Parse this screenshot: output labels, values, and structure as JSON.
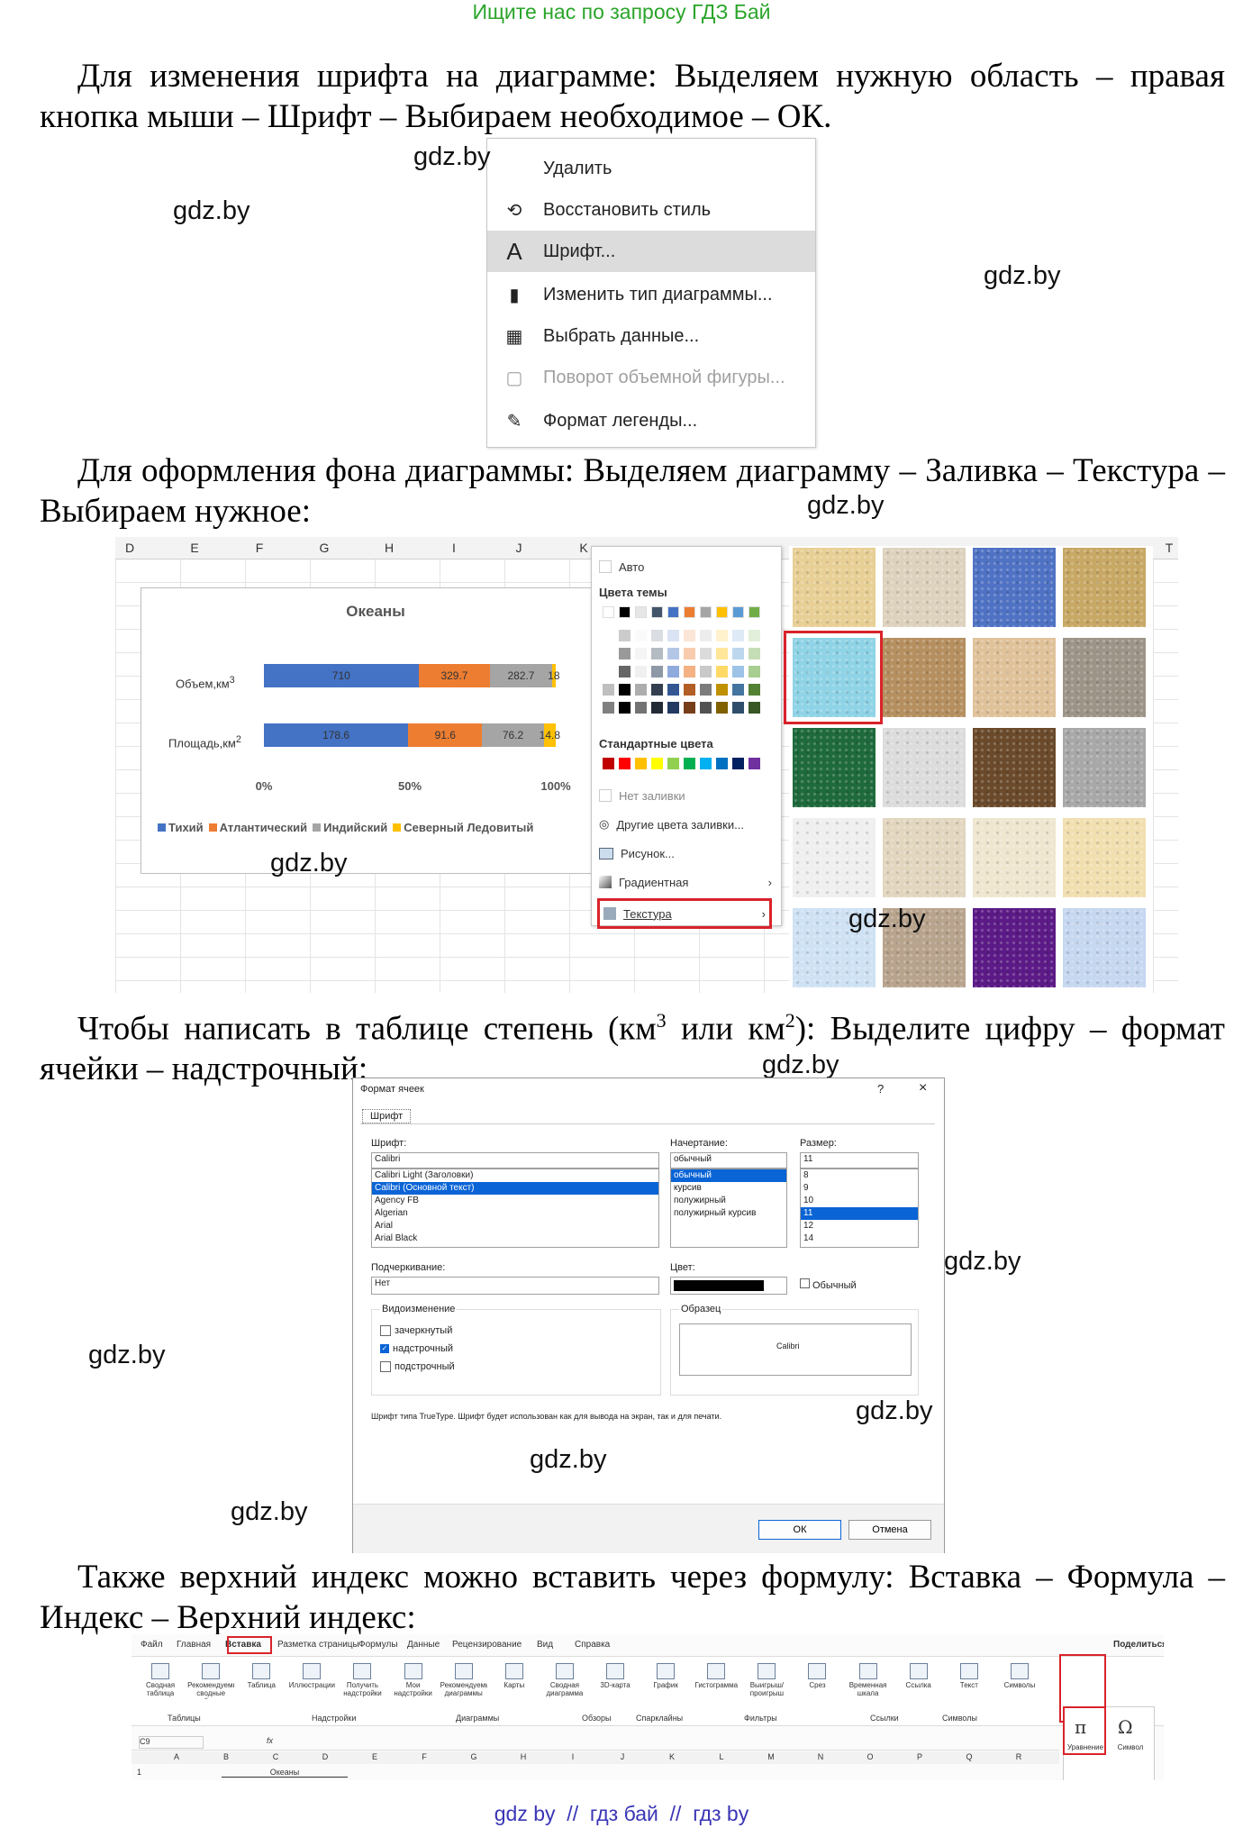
{
  "header_link": "Ищите нас по запросу ГДЗ Бай",
  "p1": "Для изменения шрифта на диаграмме: Выделяем нужную область – правая кнопка мыши – Шрифт – Выбираем необходимое – ОК.",
  "p2": "Для оформления фона диаграммы: Выделяем диаграмму – Заливка – Текстура – Выбираем нужное:",
  "p3_a": "Чтобы написать в таблице степень (км",
  "p3_sup1": "3",
  "p3_b": " или км",
  "p3_sup2": "2",
  "p3_c": "): Выделите цифру – формат ячейки – надстрочный:",
  "p4": "Также верхний индекс можно вставить через формулу: Вставка – Формула – Индекс – Верхний индекс:",
  "watermark": "gdz.by",
  "footer": "gdz by  //  гдз бай  //  гдз by",
  "context_menu": {
    "items": [
      {
        "label": "Удалить",
        "icon": "none"
      },
      {
        "label": "Восстановить стиль",
        "icon": "reset-style-icon"
      },
      {
        "label": "Шрифт...",
        "icon": "font-icon"
      },
      {
        "label": "Изменить тип диаграммы...",
        "icon": "chart-type-icon"
      },
      {
        "label": "Выбрать данные...",
        "icon": "select-data-icon"
      },
      {
        "label": "Поворот объемной фигуры...",
        "icon": "rotate-3d-icon"
      },
      {
        "label": "Формат легенды...",
        "icon": "format-legend-icon"
      }
    ]
  },
  "excel_chart": {
    "columns": [
      "D",
      "E",
      "F",
      "G",
      "H",
      "I",
      "J",
      "K"
    ],
    "right_column": "T",
    "title": "Океаны",
    "row1_label": "Объем,км",
    "row1_sup": "3",
    "row2_label": "Площадь,км",
    "row2_sup": "2",
    "row1_values": [
      "710",
      "329.7",
      "282.7",
      "18"
    ],
    "row2_values": [
      "178.6",
      "91.6",
      "76.2",
      "14.8"
    ],
    "x_ticks": [
      "0%",
      "50%",
      "100%"
    ],
    "legend": [
      "Тихий",
      "Атлантический",
      "Индийский",
      "Северный Ледовитый"
    ],
    "series_colors": [
      "#4472c4",
      "#ed7d31",
      "#a5a5a5",
      "#ffc000"
    ]
  },
  "chart_data": {
    "type": "bar",
    "title": "Океаны",
    "categories": [
      "Объем,км³",
      "Площадь,км²"
    ],
    "series": [
      {
        "name": "Тихий",
        "values": [
          710,
          178.6
        ]
      },
      {
        "name": "Атлантический",
        "values": [
          329.7,
          91.6
        ]
      },
      {
        "name": "Индийский",
        "values": [
          282.7,
          76.2
        ]
      },
      {
        "name": "Северный Ледовитый",
        "values": [
          18,
          14.8
        ]
      }
    ],
    "stacked": "percent",
    "xlim": [
      0,
      100
    ],
    "x_ticks": [
      "0%",
      "50%",
      "100%"
    ],
    "legend_position": "bottom"
  },
  "fill_menu": {
    "auto": "Авто",
    "theme_colors": "Цвета темы",
    "standard_colors": "Стандартные цвета",
    "no_fill": "Нет заливки",
    "more_colors": "Другие цвета заливки...",
    "picture": "Рисунок...",
    "gradient": "Градиентная",
    "texture": "Текстура",
    "theme_top": [
      "#ffffff",
      "#000000",
      "#e7e6e6",
      "#44546a",
      "#4472c4",
      "#ed7d31",
      "#a5a5a5",
      "#ffc000",
      "#5b9bd5",
      "#70ad47"
    ],
    "standard": [
      "#c00000",
      "#ff0000",
      "#ffc000",
      "#ffff00",
      "#92d050",
      "#00b050",
      "#00b0f0",
      "#0070c0",
      "#002060",
      "#7030a0"
    ]
  },
  "textures": [
    "#e8cf95",
    "#ddd2bd",
    "#4f72c4",
    "#c8a865",
    "#8fd3e6",
    "#b58f5f",
    "#e0c29a",
    "#9d9488",
    "#1f6a3c",
    "#dcdcdc",
    "#6a4a2a",
    "#a8a8a8",
    "#efefef",
    "#e2d6bf",
    "#efe6cf",
    "#f1dfb0",
    "#cfe2f4",
    "#b8a48d",
    "#5b1a86",
    "#c6d7f0"
  ],
  "format_dialog": {
    "title": "Формат ячеек",
    "help": "?",
    "close": "×",
    "tab": "Шрифт",
    "font_label": "Шрифт:",
    "font_value": "Calibri",
    "fonts": [
      "Calibri Light (Заголовки)",
      "Calibri (Основной текст)",
      "Agency FB",
      "Algerian",
      "Arial",
      "Arial Black"
    ],
    "style_label": "Начертание:",
    "style_value": "обычный",
    "styles": [
      "обычный",
      "курсив",
      "полужирный",
      "полужирный курсив"
    ],
    "size_label": "Размер:",
    "size_value": "11",
    "sizes": [
      "8",
      "9",
      "10",
      "11",
      "12",
      "14"
    ],
    "underline_label": "Подчеркивание:",
    "underline_value": "Нет",
    "color_label": "Цвет:",
    "normal_label": "Обычный",
    "effects_label": "Видоизменение",
    "strike": "зачеркнутый",
    "superscript": "надстрочный",
    "subscript": "подстрочный",
    "preview_label": "Образец",
    "preview_text": "Calibri",
    "note": "Шрифт типа TrueType. Шрифт будет использован как для вывода на экран, так и для печати.",
    "ok": "ОК",
    "cancel": "Отмена"
  },
  "ribbon": {
    "tabs": [
      "Файл",
      "Главная",
      "Вставка",
      "Разметка страницы",
      "Формулы",
      "Данные",
      "Рецензирование",
      "Вид",
      "Справка"
    ],
    "share": "Поделиться",
    "buttons": [
      "Сводная таблица",
      "Рекомендуемые сводные таблицы",
      "Таблица",
      "Иллюстрации",
      "Получить надстройки",
      "Мои надстройки",
      "Рекомендуемые диаграммы",
      "Карты",
      "Сводная диаграмма",
      "3D-карта",
      "График",
      "Гистограмма",
      "Выигрыш/проигрыш",
      "Срез",
      "Временная шкала",
      "Ссылка",
      "Текст",
      "Символы"
    ],
    "groups": [
      "Таблицы",
      "Надстройки",
      "Диаграммы",
      "Обзоры",
      "Спарклайны",
      "Фильтры",
      "Ссылки",
      "Символы"
    ],
    "formula_label": "Уравнение",
    "symbol_label": "Символ",
    "cell_ref": "C9",
    "fx": "fx",
    "sheet_cols": [
      "A",
      "B",
      "C",
      "D",
      "E",
      "F",
      "G",
      "H",
      "I",
      "J",
      "K",
      "L",
      "M",
      "N",
      "O",
      "P",
      "Q",
      "R"
    ],
    "row_num": "1",
    "cell_text": "Океаны"
  }
}
